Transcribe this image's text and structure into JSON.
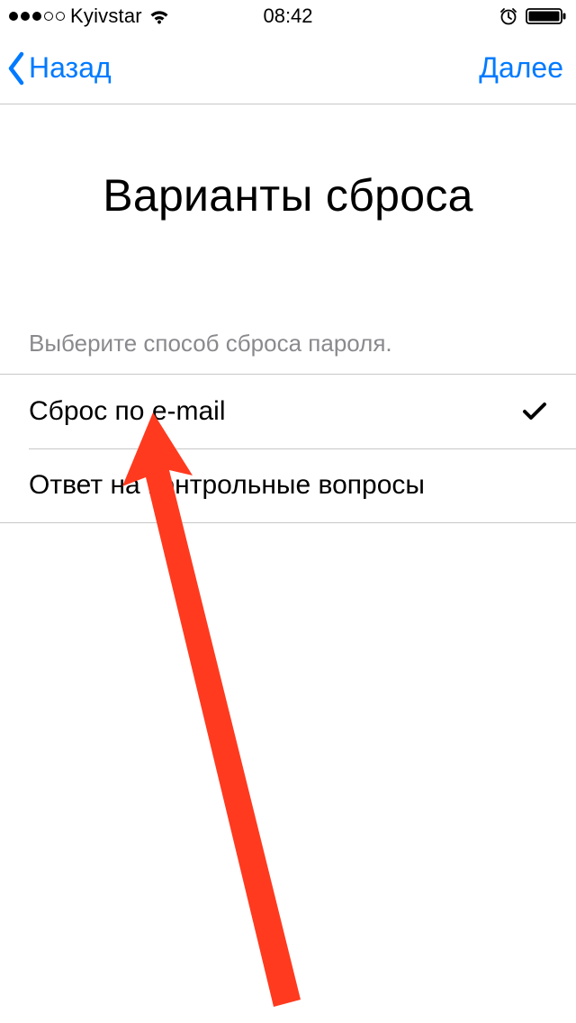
{
  "status_bar": {
    "carrier": "Kyivstar",
    "time": "08:42"
  },
  "nav": {
    "back_label": "Назад",
    "next_label": "Далее"
  },
  "page": {
    "title": "Варианты сброса",
    "section_header": "Выберите способ сброса пароля."
  },
  "options": [
    {
      "label": "Сброс по e-mail",
      "selected": true
    },
    {
      "label": "Ответ на контрольные вопросы",
      "selected": false
    }
  ],
  "colors": {
    "primary": "#007aff",
    "annotation": "#ff3a1f"
  }
}
